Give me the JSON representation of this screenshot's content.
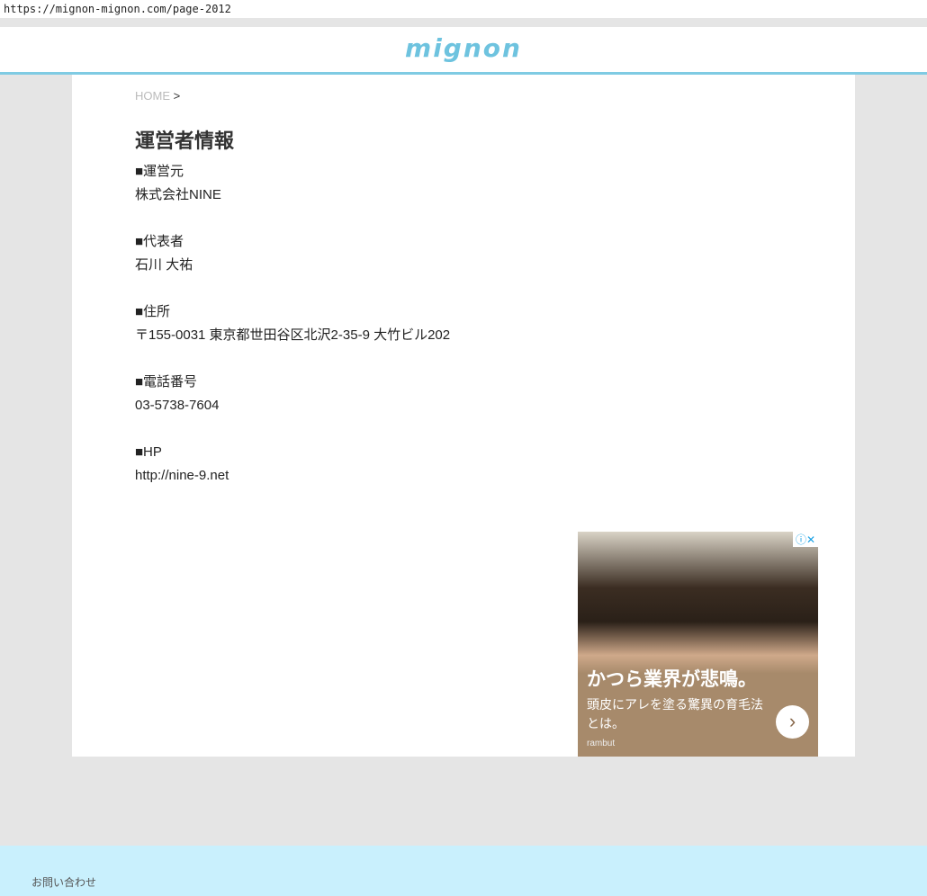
{
  "browser": {
    "url": "https://mignon-mignon.com/page-2012"
  },
  "header": {
    "logo": "mignon"
  },
  "breadcrumb": {
    "home": "HOME",
    "sep": ">"
  },
  "page": {
    "title": "運営者情報",
    "sections": [
      {
        "label": "■運営元",
        "value": "株式会社NINE"
      },
      {
        "label": "■代表者",
        "value": "石川 大祐"
      },
      {
        "label": "■住所",
        "value": "〒155-0031 東京都世田谷区北沢2-35-9 大竹ビル202"
      },
      {
        "label": "■電話番号",
        "value": "03-5738-7604"
      },
      {
        "label": "■HP",
        "value": "http://nine-9.net"
      }
    ]
  },
  "ad": {
    "controls": "ⓘ✕",
    "headline": "かつら業界が悲鳴。",
    "description": "頭皮にアレを塗る驚異の育毛法とは。",
    "sponsor": "rambut",
    "arrow": "›"
  },
  "footer": {
    "contact": "お問い合わせ"
  }
}
